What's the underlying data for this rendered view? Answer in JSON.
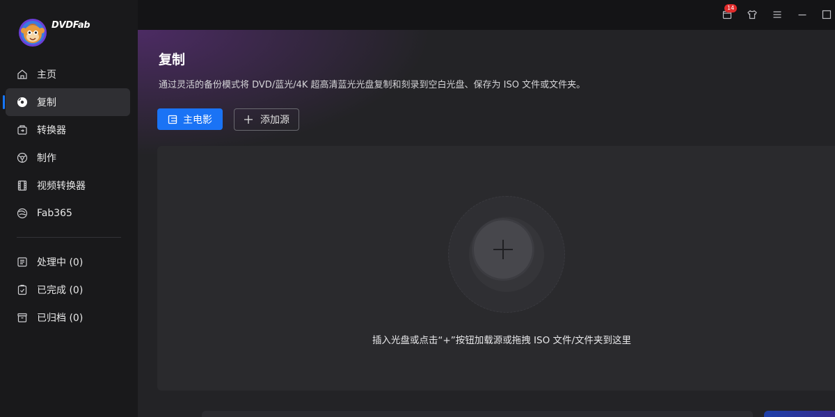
{
  "app": {
    "brand": "DVDFab"
  },
  "sidebar": {
    "items": [
      {
        "label": "主页",
        "icon": "home-icon"
      },
      {
        "label": "复制",
        "icon": "disc-copy-icon",
        "active": true
      },
      {
        "label": "转换器",
        "icon": "converter-icon"
      },
      {
        "label": "制作",
        "icon": "creator-icon"
      },
      {
        "label": "视频转换器",
        "icon": "film-icon"
      },
      {
        "label": "Fab365",
        "icon": "fab365-icon"
      }
    ],
    "tasks": [
      {
        "label": "处理中 (0)",
        "icon": "task-list-icon"
      },
      {
        "label": "已完成 (0)",
        "icon": "clipboard-check-icon"
      },
      {
        "label": "已归档 (0)",
        "icon": "archive-icon"
      }
    ]
  },
  "topbar": {
    "notification_count": "14"
  },
  "main": {
    "title": "复制",
    "description": "通过灵活的备份模式将 DVD/蓝光/4K 超高清蓝光光盘复制和刻录到空白光盘、保存为 ISO 文件或文件夹。",
    "mode_button": "主电影",
    "add_source_button": "添加源",
    "drop_hint": "插入光盘或点击“+”按钮加载源或拖拽 ISO 文件/文件夹到这里"
  },
  "colors": {
    "accent": "#1a73f5",
    "badge": "#e02b2b",
    "sidebar_bg": "#19191b",
    "main_bg": "#232326"
  }
}
